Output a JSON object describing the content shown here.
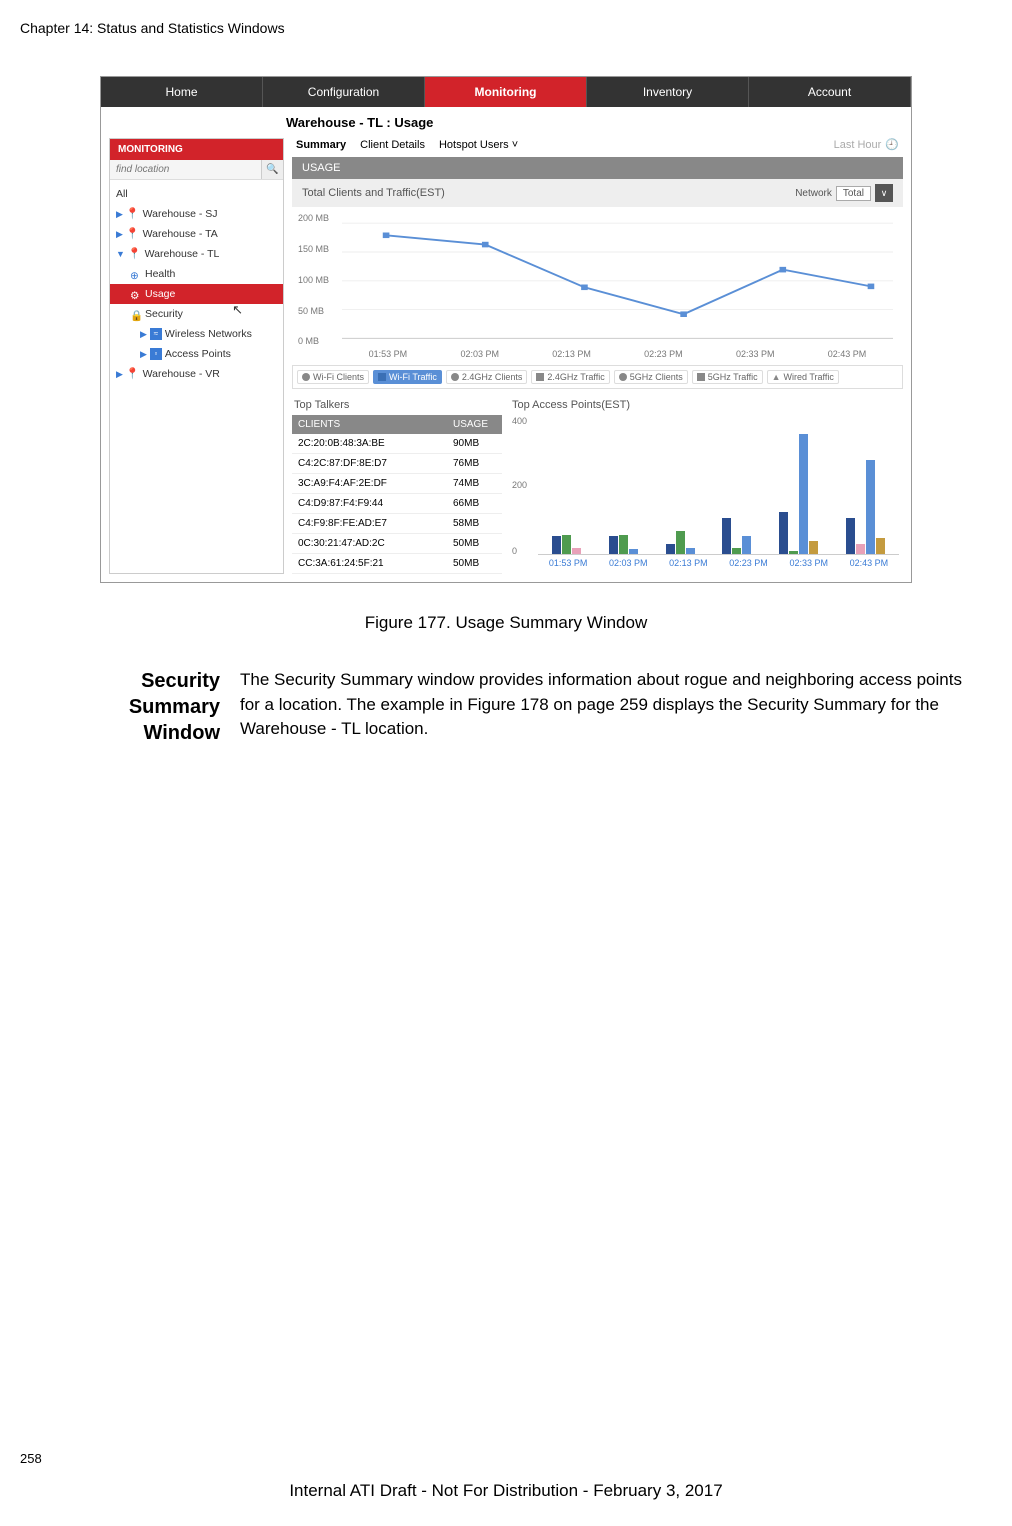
{
  "chapter": "Chapter 14: Status and Statistics Windows",
  "nav": [
    "Home",
    "Configuration",
    "Monitoring",
    "Inventory",
    "Account"
  ],
  "nav_active_idx": 2,
  "title_bar": "Warehouse - TL : Usage",
  "sidebar_label": "MONITORING",
  "search_placeholder": "find location",
  "tree": {
    "all": "All",
    "items": [
      {
        "label": "Warehouse - SJ",
        "open": false
      },
      {
        "label": "Warehouse - TA",
        "open": false
      },
      {
        "label": "Warehouse - TL",
        "open": true,
        "children": [
          {
            "label": "Health",
            "icon": "health"
          },
          {
            "label": "Usage",
            "icon": "usage",
            "active": true
          },
          {
            "label": "Security",
            "icon": "security",
            "cursor": true
          },
          {
            "label": "Wireless Networks",
            "icon": "wifi",
            "caret": true
          },
          {
            "label": "Access Points",
            "icon": "ap",
            "caret": true
          }
        ]
      },
      {
        "label": "Warehouse - VR",
        "open": false
      }
    ]
  },
  "subnav": [
    "Summary",
    "Client Details",
    "Hotspot Users ˅"
  ],
  "subnav_active_idx": 0,
  "last_hour": "Last Hour",
  "panel_label": "USAGE",
  "chart1_sub": "Total Clients and Traffic(EST)",
  "network_label": "Network",
  "network_value": "Total",
  "chart_data": {
    "line": {
      "type": "line",
      "title": "Total Clients and Traffic(EST)",
      "ylabel": "",
      "xlabel": "",
      "ylim": [
        0,
        200
      ],
      "y_ticks": [
        "200 MB",
        "150 MB",
        "100 MB",
        "50 MB",
        "0 MB"
      ],
      "x_ticks": [
        "01:53 PM",
        "02:03 PM",
        "02:13 PM",
        "02:23 PM",
        "02:33 PM",
        "02:43 PM"
      ],
      "series_name": "Wi-Fi Traffic",
      "values": [
        178,
        162,
        88,
        42,
        118,
        90
      ]
    },
    "legend": [
      {
        "name": "Wi-Fi Clients",
        "color": "#9aa0a6",
        "shape": "circle",
        "on": false
      },
      {
        "name": "Wi-Fi Traffic",
        "color": "#5a8fd6",
        "shape": "square",
        "on": true
      },
      {
        "name": "2.4GHz Clients",
        "color": "#9aa0a6",
        "shape": "circle",
        "on": false
      },
      {
        "name": "2.4GHz Traffic",
        "color": "#9aa0a6",
        "shape": "square",
        "on": false
      },
      {
        "name": "5GHz Clients",
        "color": "#9aa0a6",
        "shape": "circle",
        "on": false
      },
      {
        "name": "5GHz Traffic",
        "color": "#9aa0a6",
        "shape": "square",
        "on": false
      },
      {
        "name": "Wired Traffic",
        "color": "#9aa0a6",
        "shape": "triangle",
        "on": false
      }
    ],
    "bar": {
      "type": "bar",
      "title": "Top Access Points(EST)",
      "ylim": [
        0,
        400
      ],
      "y_ticks": [
        "400",
        "200",
        "0"
      ],
      "x_ticks": [
        "01:53 PM",
        "02:03 PM",
        "02:13 PM",
        "02:23 PM",
        "02:33 PM",
        "02:43 PM"
      ],
      "colors": [
        "#2a4d8f",
        "#4f9b4f",
        "#e8a1b8",
        "#5a8fd6",
        "#c49b3f"
      ],
      "groups": [
        [
          55,
          60,
          20,
          0,
          0
        ],
        [
          55,
          60,
          0,
          15,
          0
        ],
        [
          30,
          70,
          0,
          20,
          0
        ],
        [
          110,
          20,
          0,
          55,
          0
        ],
        [
          130,
          10,
          0,
          370,
          40
        ],
        [
          110,
          0,
          30,
          290,
          50
        ]
      ]
    }
  },
  "talkers_title": "Top Talkers",
  "ap_title": "Top Access Points(EST)",
  "talkers_hdr": [
    "CLIENTS",
    "USAGE"
  ],
  "talkers": [
    {
      "mac": "2C:20:0B:48:3A:BE",
      "usage": "90MB"
    },
    {
      "mac": "C4:2C:87:DF:8E:D7",
      "usage": "76MB"
    },
    {
      "mac": "3C:A9:F4:AF:2E:DF",
      "usage": "74MB"
    },
    {
      "mac": "C4:D9:87:F4:F9:44",
      "usage": "66MB"
    },
    {
      "mac": "C4:F9:8F:FE:AD:E7",
      "usage": "58MB"
    },
    {
      "mac": "0C:30:21:47:AD:2C",
      "usage": "50MB"
    },
    {
      "mac": "CC:3A:61:24:5F:21",
      "usage": "50MB"
    }
  ],
  "figure_caption": "Figure 177. Usage Summary Window",
  "section_heading": "Security Summary Window",
  "body_text": "The Security Summary window provides information about rogue and neighboring access points for a location. The example in Figure 178 on page 259 displays the Security Summary for the Warehouse - TL location.",
  "page_number": "258",
  "footer": "Internal ATI Draft - Not For Distribution - February 3, 2017"
}
